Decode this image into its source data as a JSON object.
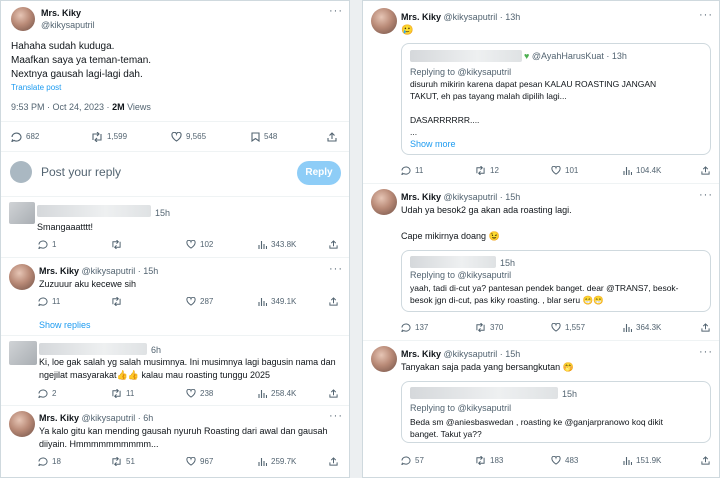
{
  "main_tweet": {
    "name": "Mrs. Kiky",
    "handle": "@kikysaputril",
    "text": "Hahaha sudah kuduga.\nMaafkan saya ya teman-teman.\nNextnya gausah lagi-lagi dah.",
    "translate": "Translate post",
    "time": "9:53 PM · Oct 24, 2023 · ",
    "views": "2M",
    "views_label": " Views",
    "replies": "682",
    "reposts": "1,599",
    "likes": "9,565",
    "bookmarks": "548"
  },
  "compose": {
    "placeholder": "Post your reply",
    "button": "Reply"
  },
  "left_replies": [
    {
      "time": "15h",
      "text": "Smangaaatttt!",
      "replies": "1",
      "reposts": "",
      "likes": "102",
      "views": "343.8K"
    },
    {
      "name": "Mrs. Kiky",
      "handle": "@kikysaputril · 15h",
      "text": "Zuzuuur aku kecewe sih",
      "replies": "11",
      "reposts": "",
      "likes": "287",
      "views": "349.1K",
      "show_replies": "Show replies"
    },
    {
      "time": "6h",
      "text": "Ki, loe gak salah yg salah musimnya. Ini musimnya lagi bagusin nama dan\nngejilat masyarakat👍👍 kalau mau roasting tunggu 2025",
      "replies": "2",
      "reposts": "11",
      "likes": "238",
      "views": "258.4K"
    },
    {
      "name": "Mrs. Kiky",
      "handle": "@kikysaputril · 6h",
      "text": "Ya kalo gitu kan mending gausah nyuruh Roasting dari awal dan gausah\ndiiyain. Hmmmmmmmmmm...",
      "replies": "18",
      "reposts": "51",
      "likes": "967",
      "views": "259.7K"
    }
  ],
  "right_tweets": [
    {
      "name": "Mrs. Kiky",
      "handle": "@kikysaputril · 13h",
      "text": "🥲",
      "quote_handle": "@AyahHarusKuat · 13h",
      "quote_replying": "Replying to @kikysaputril",
      "quote_text": "disuruh mikirin karena dapat pesan KALAU ROASTING JANGAN\nTAKUT, eh pas tayang malah dipilih lagi...\n\nDASARRRRRR....\n...",
      "show_more": "Show more",
      "replies": "11",
      "reposts": "12",
      "likes": "101",
      "views": "104.4K"
    },
    {
      "name": "Mrs. Kiky",
      "handle": "@kikysaputril · 15h",
      "text": "Udah ya besok2 ga akan ada roasting lagi.\n\nCape mikirnya doang 😉",
      "quote_time": "15h",
      "quote_replying": "Replying to @kikysaputril",
      "quote_text": "yaah, tadi di-cut ya? pantesan pendek banget. dear @TRANS7, besok-\nbesok jgn di-cut, pas kiky roasting. , blar seru 😁😁",
      "replies": "137",
      "reposts": "370",
      "likes": "1,557",
      "views": "364.3K"
    },
    {
      "name": "Mrs. Kiky",
      "handle": "@kikysaputril · 15h",
      "text": "Tanyakan saja pada yang bersangkutan 🤭",
      "quote_time": "15h",
      "quote_replying": "Replying to @kikysaputril",
      "quote_text": "Beda sm @aniesbaswedan , roasting ke @ganjarpranowo koq dikit\nbanget. Takut ya??",
      "replies": "57",
      "reposts": "183",
      "likes": "483",
      "views": "151.9K"
    }
  ],
  "colors": {
    "accent": "#1d9bf0",
    "text": "#0f1419",
    "muted": "#536471",
    "verified_heart": "#4caf50"
  }
}
